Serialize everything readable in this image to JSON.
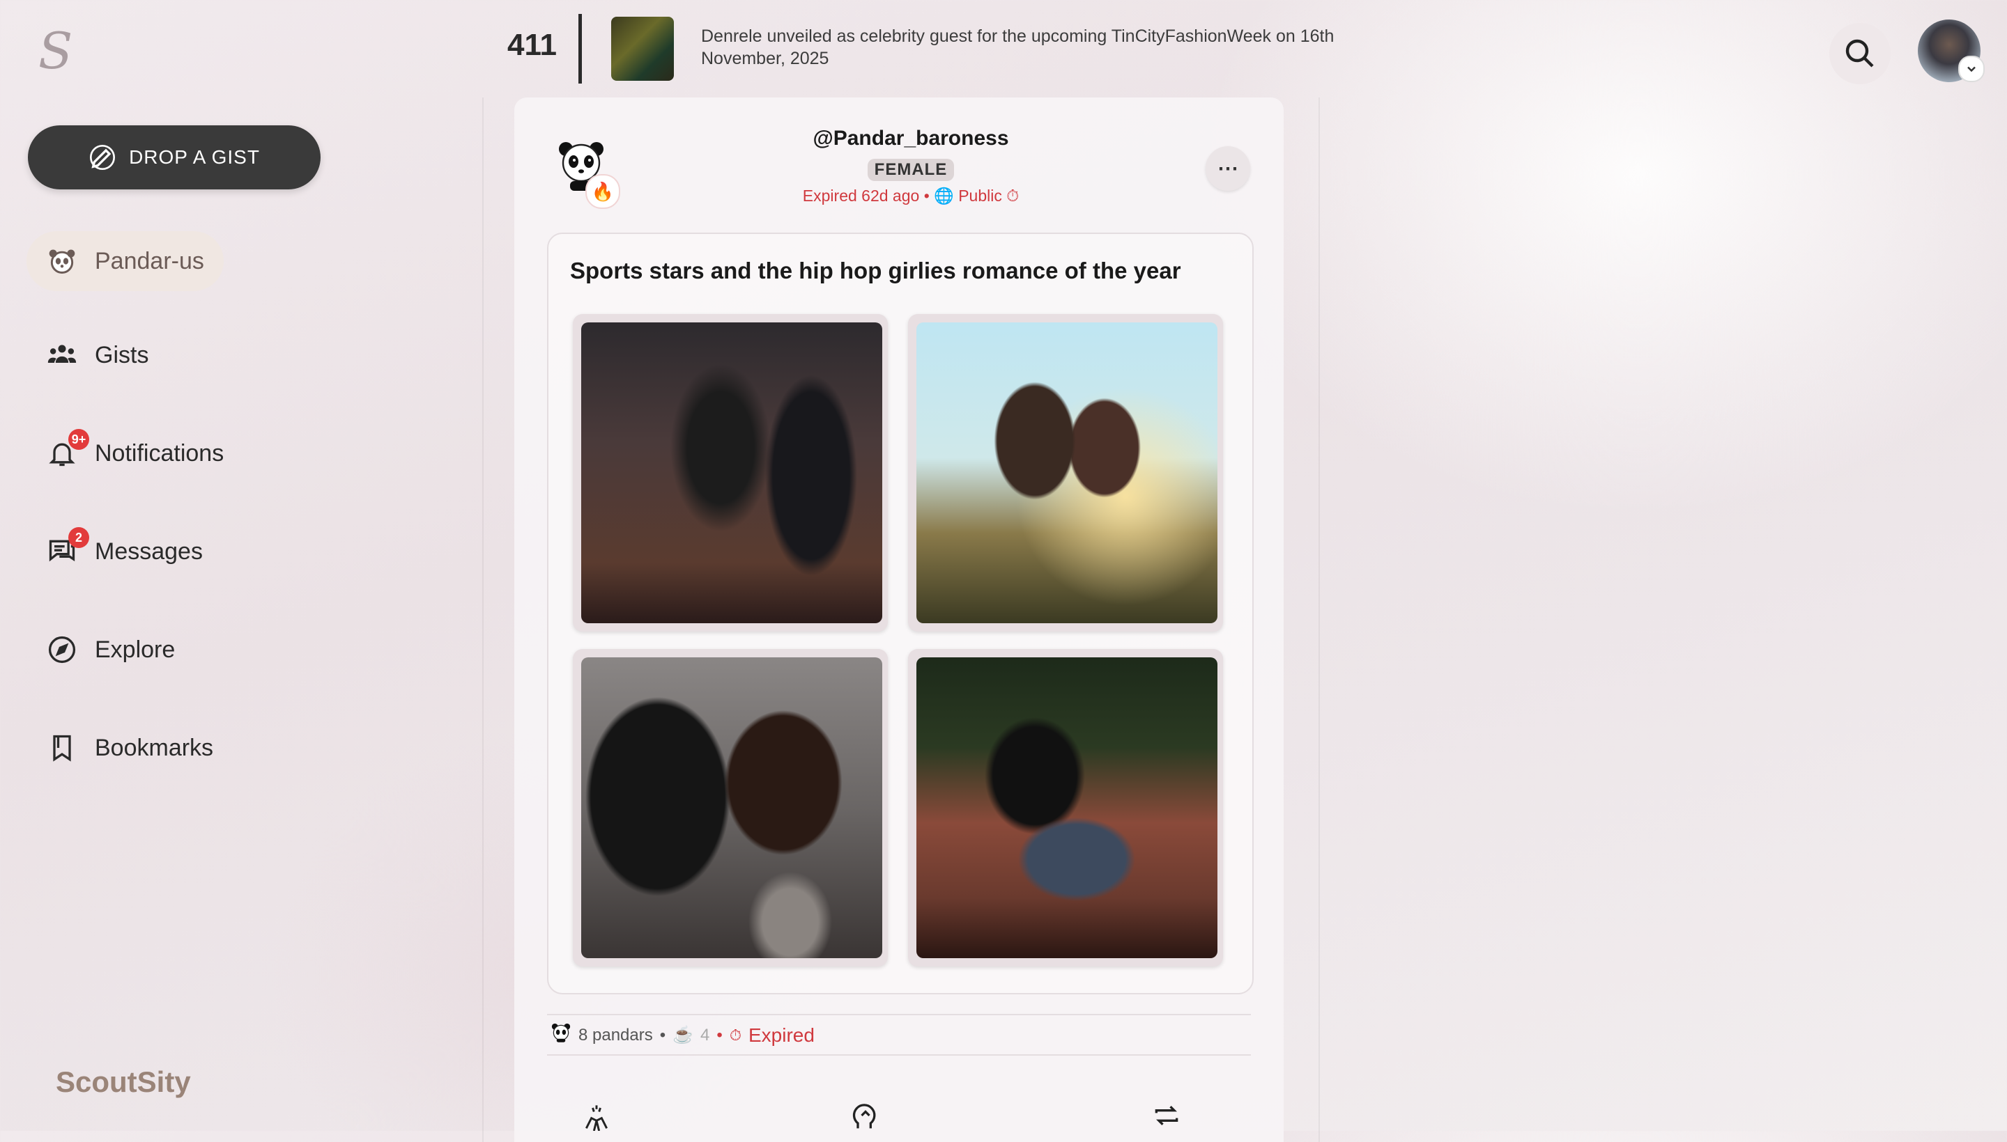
{
  "app": {
    "logo_letter": "S",
    "brand_name": "ScoutSity"
  },
  "sidebar": {
    "drop_button": "DROP A GIST",
    "items": [
      {
        "label": "Pandar-us",
        "icon": "panda-icon",
        "active": true
      },
      {
        "label": "Gists",
        "icon": "group-icon"
      },
      {
        "label": "Notifications",
        "icon": "bell-icon",
        "badge": "9+"
      },
      {
        "label": "Messages",
        "icon": "chat-icon",
        "badge": "2"
      },
      {
        "label": "Explore",
        "icon": "compass-icon"
      },
      {
        "label": "Bookmarks",
        "icon": "bookmark-icon"
      }
    ]
  },
  "header": {
    "count": "411",
    "news_text": "Denrele unveiled as celebrity guest for the upcoming TinCityFashionWeek on 16th November, 2025"
  },
  "post": {
    "username": "@Pandar_baroness",
    "gender": "FEMALE",
    "expired": "Expired 62d ago",
    "visibility": "Public",
    "title": "Sports stars and the hip hop girlies romance of the year",
    "stats": {
      "pandars": "8 pandars",
      "likes": "4",
      "status": "Expired"
    }
  },
  "colors": {
    "accent_red": "#d0393e",
    "badge_red": "#e23b3b",
    "button_dark": "#3a3a3a",
    "brand": "#9a8478"
  }
}
